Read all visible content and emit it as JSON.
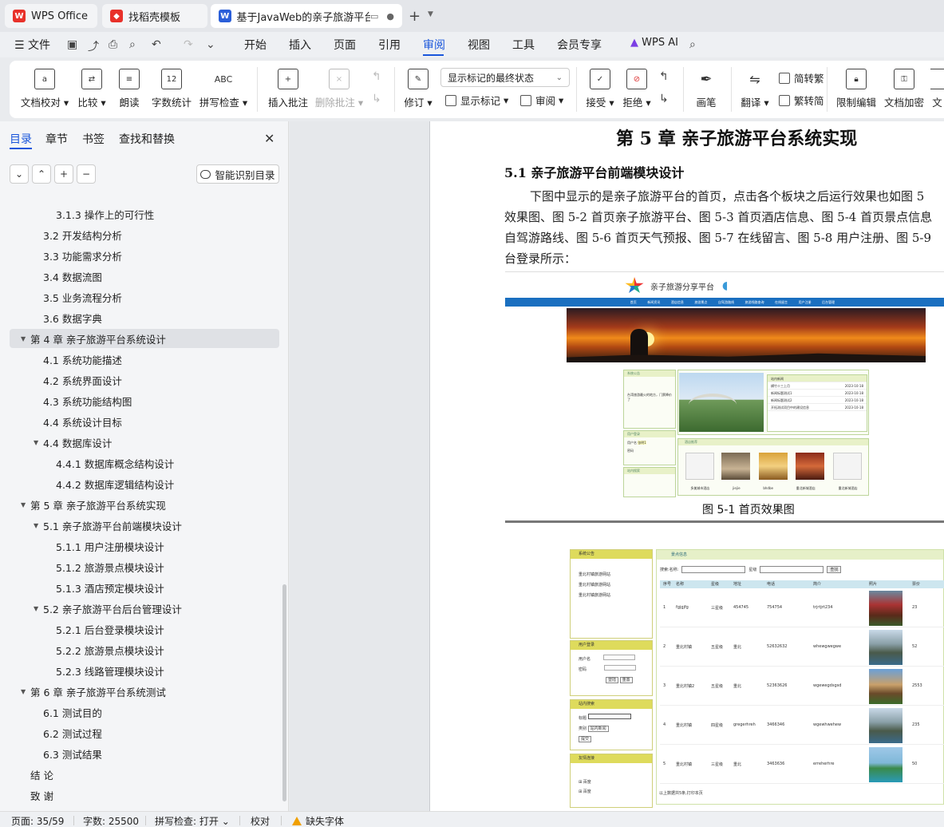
{
  "tabs": [
    {
      "label": "WPS Office",
      "icon": "wps-logo-icon"
    },
    {
      "label": "找稻壳模板",
      "icon": "docer-icon"
    },
    {
      "label": "基于JavaWeb的亲子旅游平台",
      "icon": "word-doc-icon"
    }
  ],
  "menu": {
    "file": "文件",
    "items": [
      "开始",
      "插入",
      "页面",
      "引用",
      "审阅",
      "视图",
      "工具",
      "会员专享"
    ],
    "active": "审阅",
    "ai": "WPS AI"
  },
  "ribbon": {
    "proofread": "文档校对",
    "compare": "比较",
    "read_aloud": "朗读",
    "word_count": "字数统计",
    "spell_check": "拼写检查",
    "insert_comment": "插入批注",
    "delete_comment": "删除批注",
    "track_changes": "修订",
    "markup_select": "显示标记的最终状态",
    "show_markup": "显示标记",
    "review_pane": "审阅",
    "accept": "接受",
    "reject": "拒绝",
    "ink": "画笔",
    "translate": "翻译",
    "to_traditional": "简转繁",
    "to_simplified": "繁转简",
    "restrict_edit": "限制编辑",
    "encrypt": "文档加密",
    "more": "文"
  },
  "nav": {
    "tabs": [
      "目录",
      "章节",
      "书签",
      "查找和替换"
    ],
    "smart_button": "智能识别目录",
    "toc": [
      {
        "label": "3.1.3 操作上的可行性",
        "level": 3
      },
      {
        "label": "3.2 开发结构分析",
        "level": 2
      },
      {
        "label": "3.3 功能需求分析",
        "level": 2
      },
      {
        "label": "3.4  数据流图",
        "level": 2
      },
      {
        "label": "3.5  业务流程分析",
        "level": 2
      },
      {
        "label": "3.6  数据字典",
        "level": 2
      },
      {
        "label": "第 4 章  亲子旅游平台系统设计",
        "level": 1,
        "expanded": true,
        "selected": true
      },
      {
        "label": "4.1 系统功能描述",
        "level": 2
      },
      {
        "label": "4.2 系统界面设计",
        "level": 2
      },
      {
        "label": "4.3 系统功能结构图",
        "level": 2
      },
      {
        "label": "4.4 系统设计目标",
        "level": 2
      },
      {
        "label": "4.4 数据库设计",
        "level": 2,
        "expanded": true
      },
      {
        "label": "4.4.1 数据库概念结构设计",
        "level": 3
      },
      {
        "label": "4.4.2 数据库逻辑结构设计",
        "level": 3
      },
      {
        "label": "第 5 章  亲子旅游平台系统实现",
        "level": 1,
        "expanded": true
      },
      {
        "label": "5.1 亲子旅游平台前端模块设计",
        "level": 2,
        "expanded": true
      },
      {
        "label": "5.1.1 用户注册模块设计",
        "level": 3
      },
      {
        "label": "5.1.2 旅游景点模块设计",
        "level": 3
      },
      {
        "label": "5.1.3 酒店预定模块设计",
        "level": 3
      },
      {
        "label": "5.2  亲子旅游平台后台管理设计",
        "level": 2,
        "expanded": true
      },
      {
        "label": "5.2.1 后台登录模块设计",
        "level": 3
      },
      {
        "label": "5.2.2 旅游景点模块设计",
        "level": 3
      },
      {
        "label": "5.2.3 线路管理模块设计",
        "level": 3
      },
      {
        "label": "第 6 章  亲子旅游平台系统测试",
        "level": 1,
        "expanded": true
      },
      {
        "label": "6.1  测试目的",
        "level": 2
      },
      {
        "label": "6.2  测试过程",
        "level": 2
      },
      {
        "label": "6.3  测试结果",
        "level": 2
      },
      {
        "label": "结    论",
        "level": 1
      },
      {
        "label": "致    谢",
        "level": 1
      }
    ]
  },
  "doc": {
    "chapter_title": "第 5 章  亲子旅游平台系统实现",
    "section_title": "5.1 亲子旅游平台前端模块设计",
    "paragraph_lines": [
      "下图中显示的是亲子旅游平台的首页，点击各个板块之后运行效果也如图 5",
      "效果图、图 5-2 首页亲子旅游平台、图 5-3 首页酒店信息、图 5-4 首页景点信息",
      "自驾游路线、图 5-6 首页天气预报、图 5-7 在线留言、图 5-8 用户注册、图 5-9",
      "台登录所示："
    ],
    "figure1_caption": "图 5-1 首页效果图",
    "figure1": {
      "site_title": "亲子旅游分享平台",
      "nav_items": [
        "首页",
        "新闻资讯",
        "酒店信息",
        "旅游景点",
        "自驾游路线",
        "旅游线路查询",
        "在线留言",
        "用户注册",
        "后台管理"
      ],
      "notice_header": "系统公告",
      "notice_text": "台湾旅游最火的地方，门票降价了",
      "login_header": "用户登录",
      "user_label": "用户名",
      "user_value": "张明1",
      "pwd_label": "密码",
      "search_header": "站内搜索",
      "news_header": "站内新闻",
      "news": [
        {
          "title": "横竹十三上月",
          "date": "2023-10-18"
        },
        {
          "title": "新闻标题测试1",
          "date": "2023-10-18"
        },
        {
          "title": "新闻标题测试2",
          "date": "2023-10-18"
        },
        {
          "title": "开拓测试项目中的建设信息",
          "date": "2023-10-18"
        }
      ],
      "hotel_header": "酒店推荐",
      "hotels": [
        "多美城市酒店",
        "jiejie",
        "bhdbe",
        "重北新城酒店",
        "重北新城酒店"
      ]
    },
    "figure2": {
      "side_notice": "系统公告",
      "notice_items": [
        "重北村镇旅游网站",
        "重北村镇旅游网站",
        "重北村镇旅游网站"
      ],
      "login_header": "用户登录",
      "user_label": "用户名",
      "pwd_label": "密码",
      "login_btn": "登陆",
      "reset_btn": "重置",
      "search_header": "站内搜索",
      "title_label": "标题",
      "type_label": "类别",
      "type_value": "站内新闻",
      "submit_btn": "提交",
      "links_header": "友情连接",
      "links": [
        "百度",
        "百度"
      ],
      "main_header": "景点信息",
      "search_name": "搜索:名称:",
      "search_level": "星级",
      "search_btn": "查找",
      "columns": [
        "序号",
        "名称",
        "星级",
        "地址",
        "电话",
        "简介",
        "照片",
        "票价"
      ],
      "rows": [
        {
          "no": "1",
          "name": "fgjgjfg",
          "star": "三星级",
          "addr": "454745",
          "phone": "754754",
          "intro": "trjrtjrt234",
          "price": "23",
          "pic": "temple-photo"
        },
        {
          "no": "2",
          "name": "重北村镇",
          "star": "五星级",
          "addr": "重北",
          "phone": "52632632",
          "intro": "whewgwegwe",
          "price": "52",
          "pic": "karst-photo"
        },
        {
          "no": "3",
          "name": "重北村镇2",
          "star": "五星级",
          "addr": "重北",
          "phone": "52363626",
          "intro": "wgewegdsgsd",
          "price": "2553",
          "pic": "tower-photo"
        },
        {
          "no": "4",
          "name": "重北村镇",
          "star": "四星级",
          "addr": "gregerhreh",
          "phone": "3466346",
          "intro": "wgewhwehew",
          "price": "235",
          "pic": "karst-photo"
        },
        {
          "no": "5",
          "name": "重北村镇",
          "star": "三星级",
          "addr": "重北",
          "phone": "3463636",
          "intro": "erreherhre",
          "price": "50",
          "pic": "island-photo"
        }
      ],
      "footer": "以上数据共5条,打印本页"
    }
  },
  "status": {
    "page": "页面: 35/59",
    "words": "字数: 25500",
    "spell": "拼写检查: 打开",
    "proof": "校对",
    "missing_font": "缺失字体"
  }
}
